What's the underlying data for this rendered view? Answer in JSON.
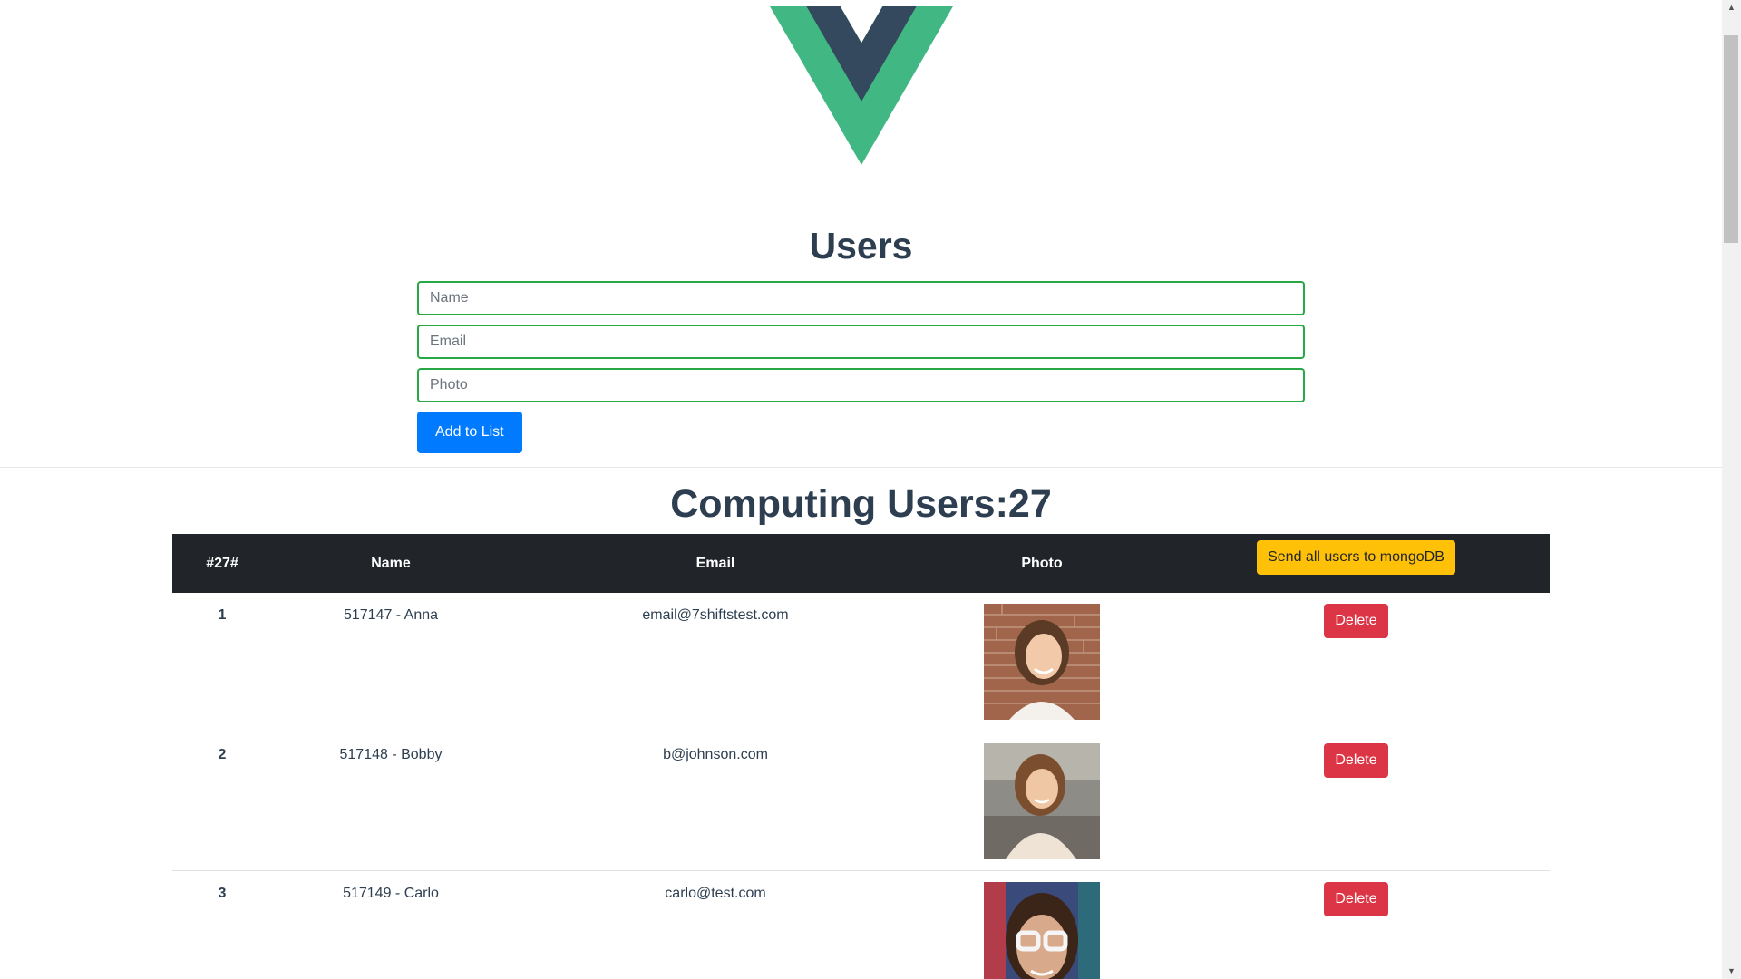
{
  "header": {
    "logo_colors": {
      "outer": "#41b883",
      "inner": "#34495e"
    },
    "title": "Users"
  },
  "form": {
    "name_placeholder": "Name",
    "email_placeholder": "Email",
    "photo_placeholder": "Photo",
    "add_label": "Add to List"
  },
  "list": {
    "title": "Computing Users:27",
    "headers": {
      "num": "#27#",
      "name": "Name",
      "email": "Email",
      "photo": "Photo"
    },
    "send_label": "Send all users to mongoDB",
    "rows": [
      {
        "num": "1",
        "name": "517147 - Anna",
        "email": "email@7shiftstest.com",
        "delete_label": "Delete"
      },
      {
        "num": "2",
        "name": "517148 - Bobby",
        "email": "b@johnson.com",
        "delete_label": "Delete"
      },
      {
        "num": "3",
        "name": "517149 - Carlo",
        "email": "carlo@test.com",
        "delete_label": "Delete"
      }
    ]
  },
  "colors": {
    "field_border": "#28a745",
    "add_button": "#007bff",
    "send_button": "#ffc107",
    "delete_button": "#dc3545",
    "table_header": "#212529"
  }
}
